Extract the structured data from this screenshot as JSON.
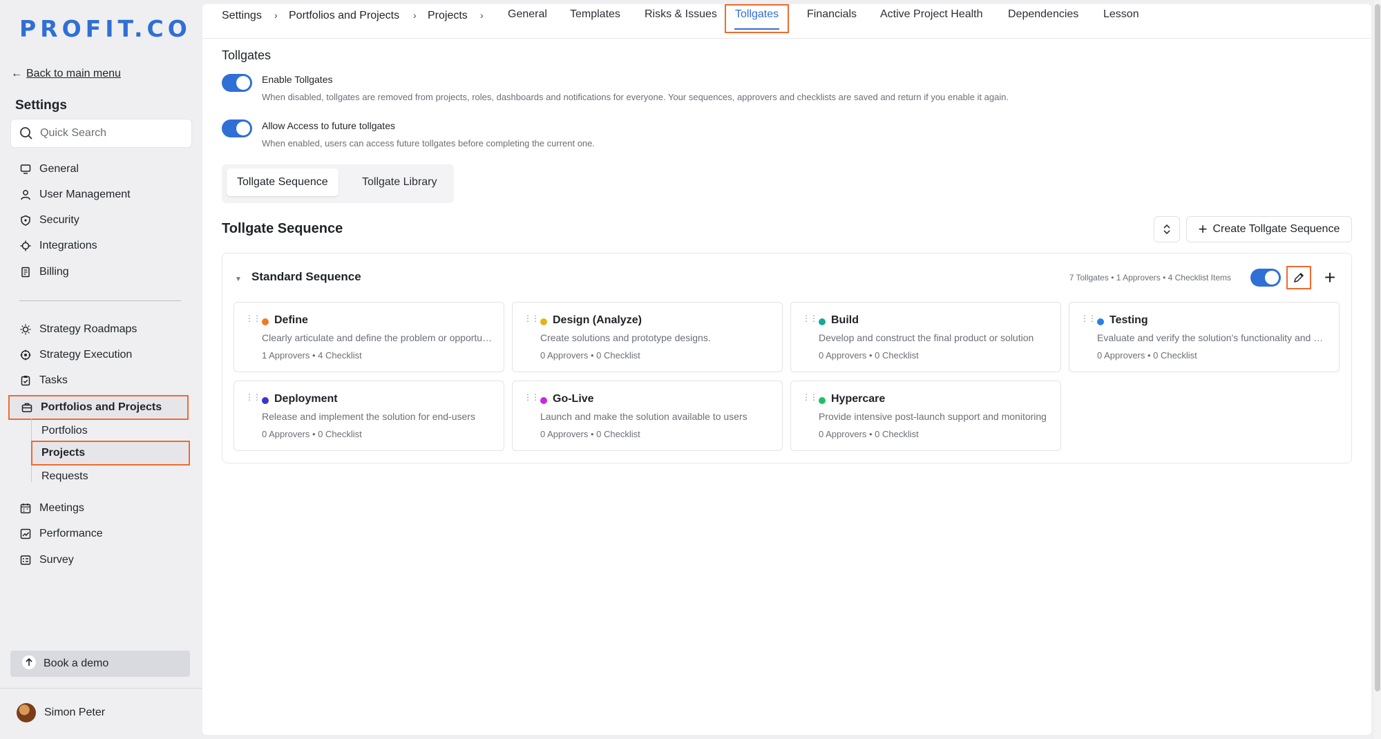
{
  "sidebar": {
    "logo": "PROFIT.CO",
    "back_link": "Back to main menu",
    "heading": "Settings",
    "search_placeholder": "Quick Search",
    "items": [
      {
        "label": "General",
        "icon": "monitor-icon"
      },
      {
        "label": "User Management",
        "icon": "user-icon"
      },
      {
        "label": "Security",
        "icon": "shield-icon"
      },
      {
        "label": "Integrations",
        "icon": "gear-icon"
      },
      {
        "label": "Billing",
        "icon": "receipt-icon"
      }
    ],
    "items2": [
      {
        "label": "Strategy Roadmaps",
        "icon": "sun-icon"
      },
      {
        "label": "Strategy Execution",
        "icon": "target-icon"
      },
      {
        "label": "Tasks",
        "icon": "clipboard-check-icon"
      },
      {
        "label": "Portfolios and Projects",
        "icon": "briefcase-icon"
      }
    ],
    "subitems": [
      "Portfolios",
      "Projects",
      "Requests"
    ],
    "items3": [
      {
        "label": "Meetings",
        "icon": "calendar-icon"
      },
      {
        "label": "Performance",
        "icon": "chart-icon"
      },
      {
        "label": "Survey",
        "icon": "form-icon"
      }
    ],
    "book_demo": "Book a demo",
    "user_name": "Simon Peter"
  },
  "breadcrumb": [
    "Settings",
    "Portfolios and Projects",
    "Projects"
  ],
  "tabs": [
    "General",
    "Templates",
    "Risks & Issues",
    "Tollgates",
    "Financials",
    "Active Project Health",
    "Dependencies",
    "Lesson"
  ],
  "active_tab": "Tollgates",
  "page": {
    "title": "Tollgates",
    "options": [
      {
        "label": "Enable Tollgates",
        "desc": "When disabled, tollgates are removed from projects, roles, dashboards and notifications for everyone. Your sequences, approvers and checklists are saved and return if you enable it again.",
        "enabled": true
      },
      {
        "label": "Allow Access to future tollgates",
        "desc": "When enabled, users can access future tollgates before completing the current one.",
        "enabled": true
      }
    ],
    "segments": [
      "Tollgate Sequence",
      "Tollgate Library"
    ],
    "active_segment": "Tollgate Sequence",
    "sequence_heading": "Tollgate Sequence",
    "create_button": "Create Tollgate Sequence"
  },
  "sequence": {
    "name": "Standard Sequence",
    "meta": "7 Tollgates • 1 Approvers • 4 Checklist Items",
    "enabled": true,
    "tollgates": [
      {
        "name": "Define",
        "color": "#f07a22",
        "desc": "Clearly articulate and define the problem or opportunity",
        "meta": "1 Approvers • 4 Checklist"
      },
      {
        "name": "Design (Analyze)",
        "color": "#e5b21b",
        "desc": "Create solutions and prototype designs.",
        "meta": "0 Approvers • 0 Checklist"
      },
      {
        "name": "Build",
        "color": "#16a89a",
        "desc": "Develop and construct the final product or solution",
        "meta": "0 Approvers • 0 Checklist"
      },
      {
        "name": "Testing",
        "color": "#2a7fe0",
        "desc": "Evaluate and verify the solution's functionality and quality",
        "meta": "0 Approvers • 0 Checklist"
      },
      {
        "name": "Deployment",
        "color": "#3b35c9",
        "desc": "Release and implement the solution for end-users",
        "meta": "0 Approvers • 0 Checklist"
      },
      {
        "name": "Go-Live",
        "color": "#c42be0",
        "desc": "Launch and make the solution available to users",
        "meta": "0 Approvers • 0 Checklist"
      },
      {
        "name": "Hypercare",
        "color": "#1fbf6a",
        "desc": "Provide intensive post-launch support and monitoring",
        "meta": "0 Approvers • 0 Checklist"
      }
    ]
  }
}
